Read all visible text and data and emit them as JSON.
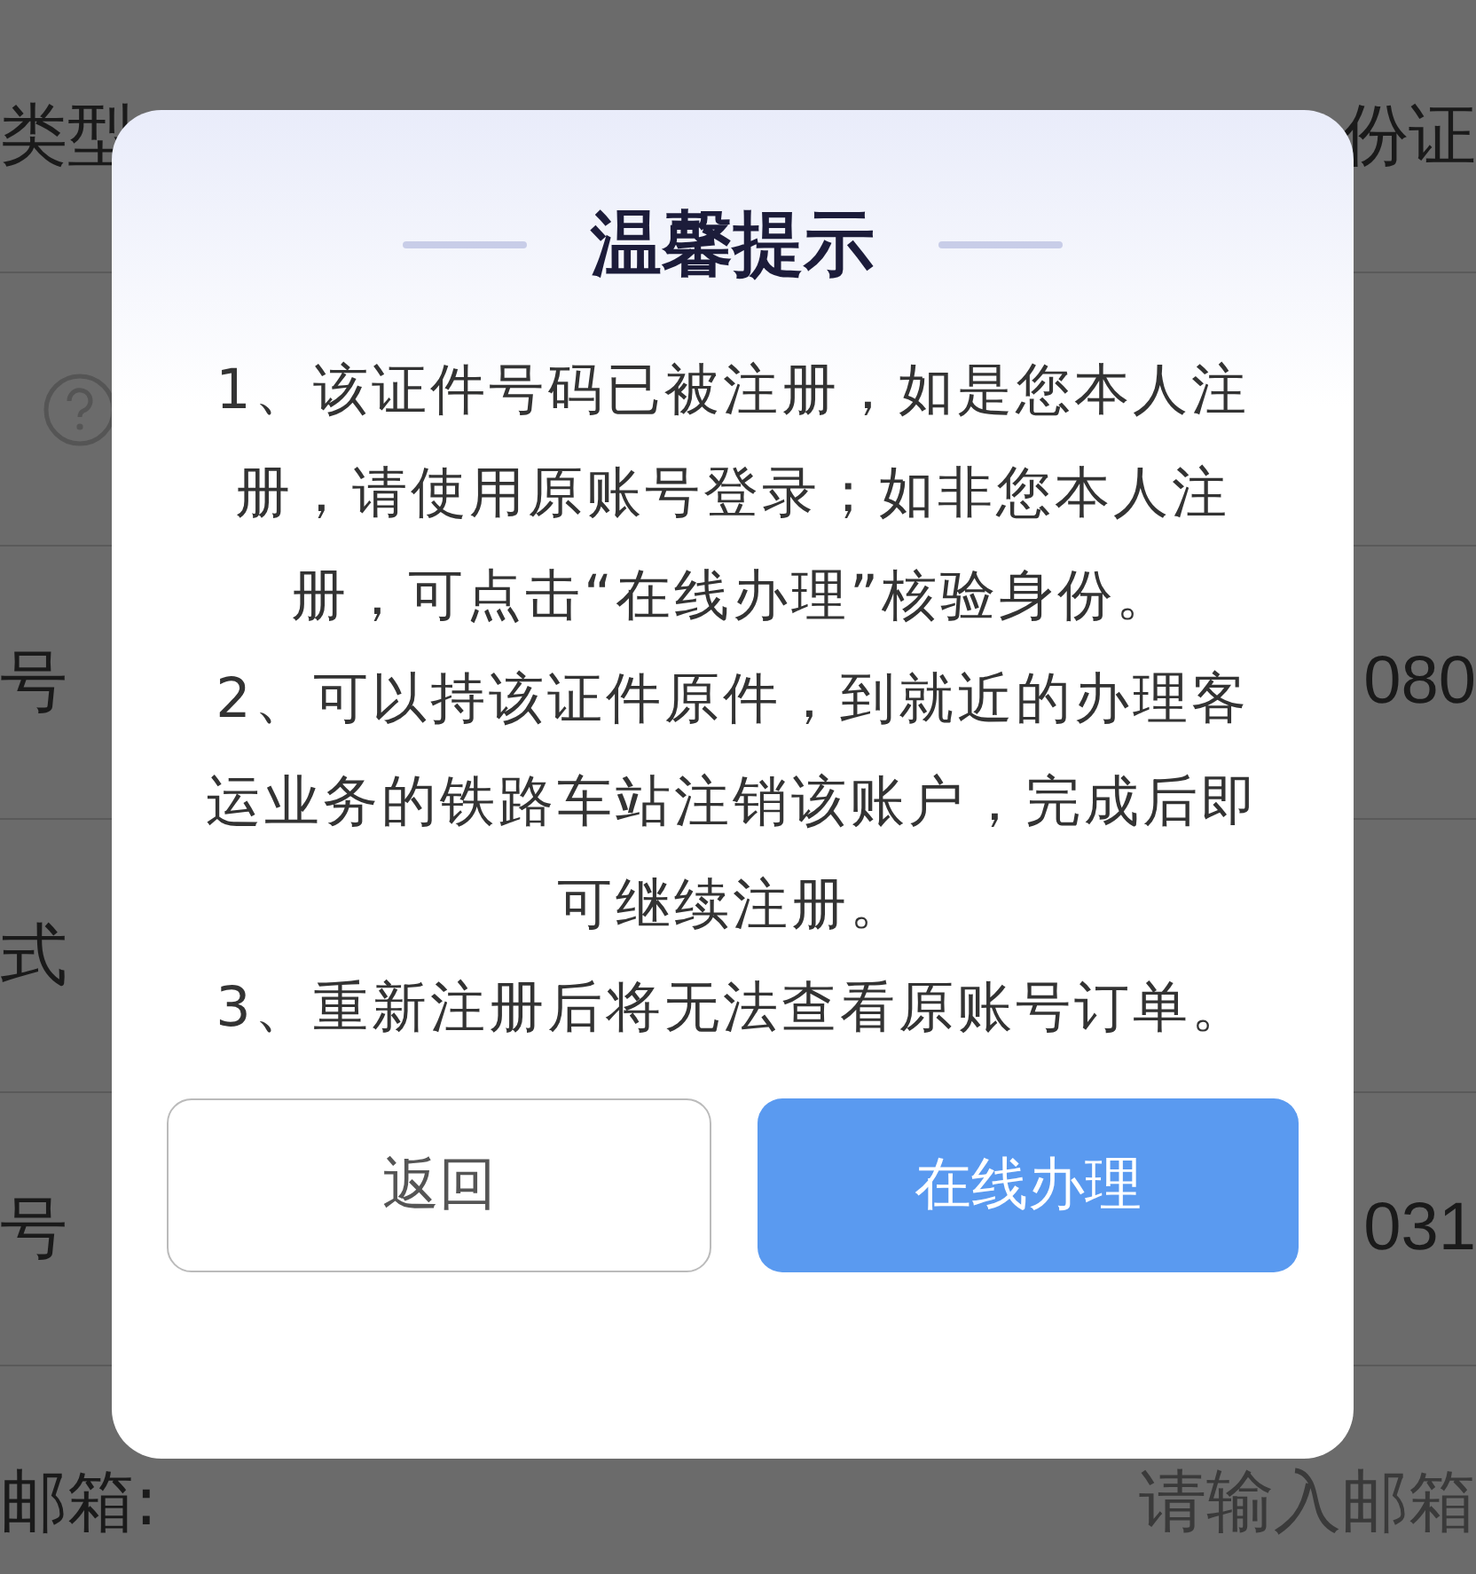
{
  "form_rows": [
    {
      "label": "类型",
      "value": "份证"
    },
    {
      "help": true
    },
    {
      "label": "号",
      "value": "080"
    },
    {
      "label": "式"
    },
    {
      "label": "号",
      "value": "031"
    },
    {
      "label": "邮箱:",
      "placeholder": "请输入邮箱"
    }
  ],
  "dialog": {
    "title": "温馨提示",
    "paragraphs": [
      "1、该证件号码已被注册，如是您本人注册，请使用原账号登录；如非您本人注册，可点击“在线办理”核验身份。",
      "2、可以持该证件原件，到就近的办理客运业务的铁路车站注销该账户，完成后即可继续注册。",
      "3、重新注册后将无法查看原账号订单。"
    ],
    "buttons": [
      {
        "label": "返回",
        "kind": "secondary"
      },
      {
        "label": "在线办理",
        "kind": "primary"
      }
    ]
  }
}
